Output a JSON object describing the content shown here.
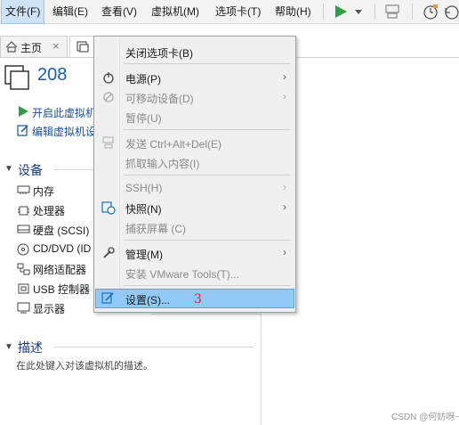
{
  "menubar": {
    "items": [
      {
        "label": "文件(F)"
      },
      {
        "label": "编辑(E)"
      },
      {
        "label": "查看(V)"
      },
      {
        "label": "虚拟机(M)"
      },
      {
        "label": "选项卡(T)"
      },
      {
        "label": "帮助(H)"
      }
    ],
    "toolbar_icons": [
      "play-icon",
      "dropdown-arrow-icon",
      "send-keys-icon",
      "snapshot-icon",
      "revert-snapshot-icon"
    ]
  },
  "tabs": [
    {
      "label": "主页",
      "icon": "home-icon"
    },
    {
      "label": "",
      "icon": "vm-icon"
    }
  ],
  "vm": {
    "name": "208",
    "actions": {
      "power_on": "开启此虚拟机",
      "edit_settings": "编辑虚拟机设"
    }
  },
  "devices": {
    "title": "设备",
    "items": [
      {
        "label": "内存",
        "icon": "memory-icon"
      },
      {
        "label": "处理器",
        "icon": "cpu-icon"
      },
      {
        "label": "硬盘 (SCSI)",
        "icon": "hard-disk-icon"
      },
      {
        "label": "CD/DVD (ID",
        "icon": "cd-dvd-icon"
      },
      {
        "label": "网络适配器",
        "icon": "network-adapter-icon"
      },
      {
        "label": "USB 控制器",
        "icon": "usb-icon"
      },
      {
        "label": "显示器",
        "icon": "display-icon"
      }
    ]
  },
  "description": {
    "title": "描述",
    "placeholder": "在此处键入对该虚拟机的描述。"
  },
  "context_menu": {
    "items": [
      {
        "label": "关闭选项卡(B)",
        "enabled": true,
        "submenu": false
      },
      {
        "label": "电源(P)",
        "enabled": true,
        "submenu": true,
        "icon": "power-icon"
      },
      {
        "label": "可移动设备(D)",
        "enabled": false,
        "submenu": true,
        "icon": "removable-devices-icon"
      },
      {
        "label": "暂停(U)",
        "enabled": false,
        "submenu": false
      },
      {
        "label": "发送 Ctrl+Alt+Del(E)",
        "enabled": false,
        "submenu": false,
        "icon": "send-ctrl-alt-del-icon"
      },
      {
        "label": "抓取输入内容(I)",
        "enabled": false,
        "submenu": false
      },
      {
        "label": "SSH(H)",
        "enabled": false,
        "submenu": true
      },
      {
        "label": "快照(N)",
        "enabled": true,
        "submenu": true,
        "icon": "snapshot-icon"
      },
      {
        "label": "捕获屏幕 (C)",
        "enabled": false,
        "submenu": false
      },
      {
        "label": "管理(M)",
        "enabled": true,
        "submenu": true,
        "icon": "wrench-icon"
      },
      {
        "label": "安装 VMware Tools(T)...",
        "enabled": false,
        "submenu": false
      },
      {
        "label": "设置(S)...",
        "enabled": true,
        "submenu": false,
        "highlighted": true,
        "icon": "settings-icon"
      }
    ],
    "submenu_arrow": "›"
  },
  "annotation": "3",
  "watermark": "CSDN @何妨呀~",
  "colors": {
    "accent": "#1a5fb0",
    "highlight": "#91c9f7",
    "play": "#2ea043",
    "annotation": "#e02020"
  }
}
